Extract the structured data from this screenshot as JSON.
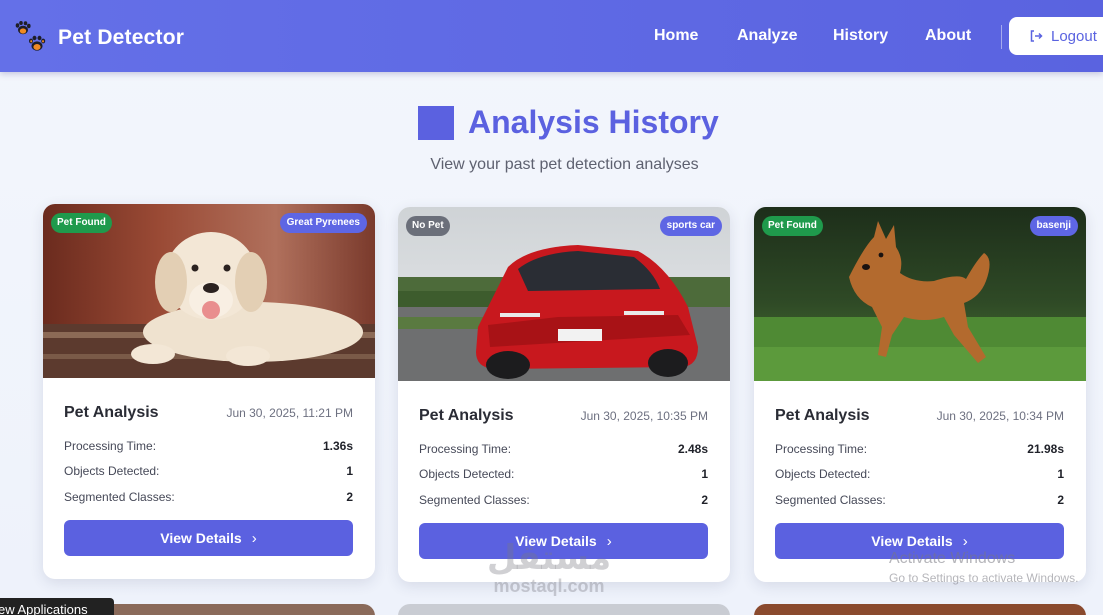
{
  "navbar": {
    "brand": "Pet Detector",
    "links": [
      {
        "label": "Home"
      },
      {
        "label": "Analyze"
      },
      {
        "label": "History"
      },
      {
        "label": "About"
      }
    ],
    "logout_label": "Logout"
  },
  "header": {
    "title": "Analysis History",
    "subtitle": "View your past pet detection analyses"
  },
  "labels": {
    "processing_time": "Processing Time:",
    "objects_detected": "Objects Detected:",
    "segmented_classes": "Segmented Classes:",
    "view_details": "View Details"
  },
  "cards": [
    {
      "status": "Pet Found",
      "status_color": "#1f9a4c",
      "class_label": "Great Pyrenees",
      "title": "Pet Analysis",
      "date": "Jun 30, 2025, 11:21 PM",
      "processing_time": "1.36s",
      "objects_detected": "1",
      "segmented_classes": "2"
    },
    {
      "status": "No Pet",
      "status_color": "#6b6f7a",
      "class_label": "sports car",
      "title": "Pet Analysis",
      "date": "Jun 30, 2025, 10:35 PM",
      "processing_time": "2.48s",
      "objects_detected": "1",
      "segmented_classes": "2"
    },
    {
      "status": "Pet Found",
      "status_color": "#1f9a4c",
      "class_label": "basenji",
      "title": "Pet Analysis",
      "date": "Jun 30, 2025, 10:34 PM",
      "processing_time": "21.98s",
      "objects_detected": "1",
      "segmented_classes": "2"
    }
  ],
  "overlays": {
    "watermark_arabic": "مستقل",
    "watermark_latin": "mostaql.com",
    "activate_title": "Activate Windows",
    "activate_sub": "Go to Settings to activate Windows.",
    "taskbar_tip": "ew Applications"
  },
  "colors": {
    "accent": "#5b61e0",
    "navbar": "#6470e8",
    "pet_found": "#1f9a4c",
    "no_pet": "#6b6f7a"
  }
}
